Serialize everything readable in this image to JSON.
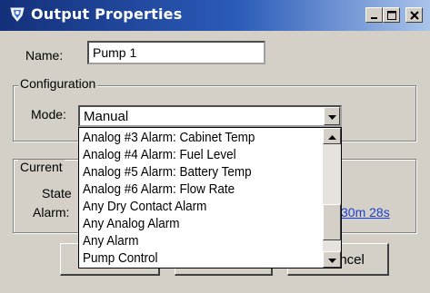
{
  "window": {
    "title": "Output Properties",
    "title_bar_color": "#2b5bb9",
    "app_icon": "shield-icon",
    "controls": [
      "minimize-icon",
      "maximize-icon",
      "close-icon"
    ]
  },
  "name_field": {
    "label": "Name:",
    "value": "Pump 1"
  },
  "configuration": {
    "group_title": "Configuration",
    "mode_label": "Mode:",
    "mode_value": "Manual"
  },
  "mode_dropdown": {
    "items": [
      "Analog #3 Alarm: Cabinet Temp",
      "Analog #4 Alarm: Fuel Level",
      "Analog #5 Alarm: Battery Temp",
      "Analog #6 Alarm: Flow Rate",
      "Any Dry Contact Alarm",
      "Any Analog Alarm",
      "Any Alarm",
      "Pump Control"
    ],
    "scroll_position": 0.85
  },
  "current": {
    "group_title": "Current",
    "state_label": "State",
    "alarm_label": "Alarm:",
    "alarm_time": "30m 28s"
  },
  "buttons": {
    "cancel_partial": "ancel"
  }
}
